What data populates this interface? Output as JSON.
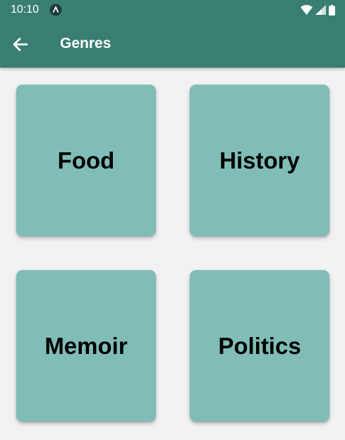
{
  "status_bar": {
    "time": "10:10",
    "app_icon": "app-notification-icon",
    "wifi_icon": "wifi-icon",
    "signal_icon": "cell-signal-icon",
    "battery_icon": "battery-icon"
  },
  "app_bar": {
    "back_icon": "arrow-back-icon",
    "title": "Genres"
  },
  "genres": [
    {
      "label": "Food"
    },
    {
      "label": "History"
    },
    {
      "label": "Memoir"
    },
    {
      "label": "Politics"
    }
  ],
  "colors": {
    "primary": "#3a7e72",
    "tile": "#80bdb7",
    "background": "#f2f2f2"
  }
}
